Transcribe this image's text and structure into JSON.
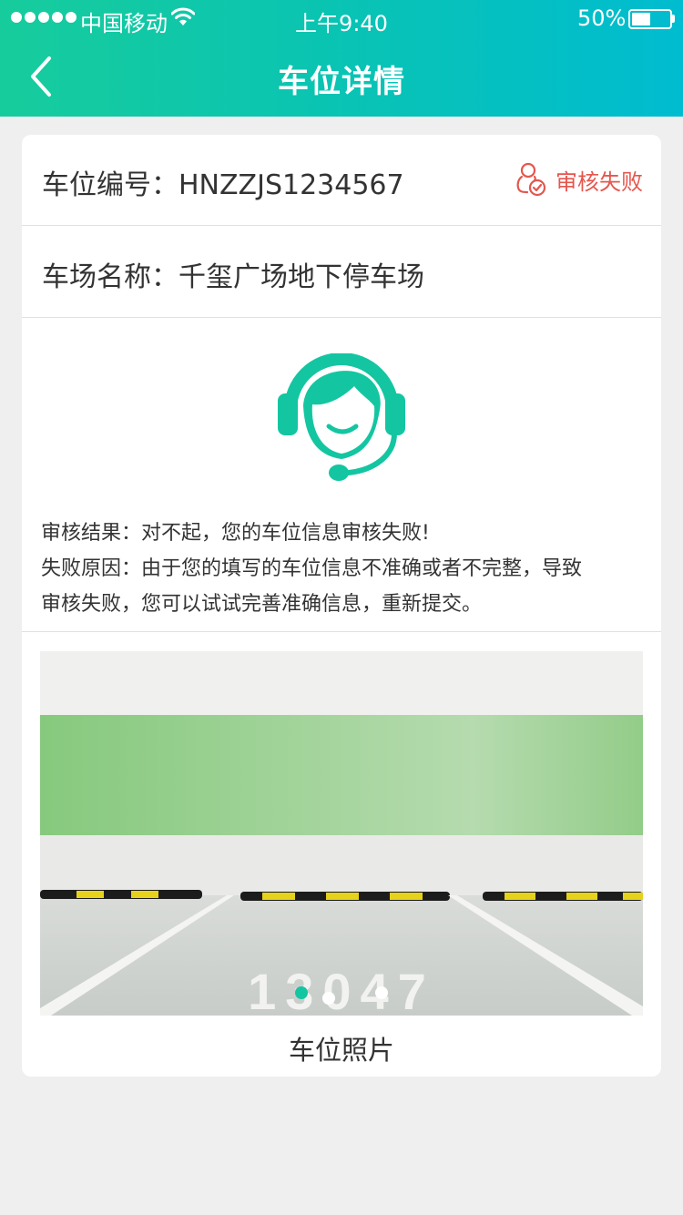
{
  "status_bar": {
    "carrier": "中国移动",
    "time": "上午9:40",
    "battery": "50%",
    "battery_level": 0.5
  },
  "nav": {
    "title": "车位详情",
    "back_icon": "chevron-left-icon"
  },
  "detail": {
    "space_no_label": "车位编号：",
    "space_no": "HNZZJS1234567",
    "status_label": "审核失败",
    "status_icon": "user-check-icon",
    "status_color": "#e4574e",
    "lot_label": "车场名称：",
    "lot_name": "千玺广场地下停车场"
  },
  "result": {
    "icon": "customer-service-agent-icon",
    "accent": "#13c6a1",
    "line1": "审核结果：对不起，您的车位信息审核失败!",
    "line2": "失败原因：由于您的填写的车位信息不准确或者不完整，导致",
    "line3": "审核失败，您可以试试完善准确信息，重新提交。"
  },
  "photo": {
    "caption": "车位照片",
    "slide_count": 3,
    "active_slide": 1,
    "floor_number": "13047"
  }
}
